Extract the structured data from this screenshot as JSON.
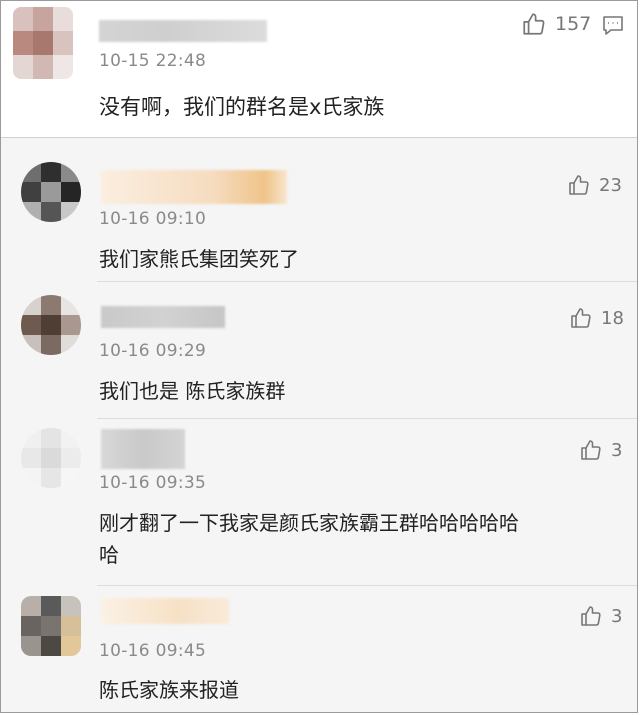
{
  "main": {
    "time": "10-15 22:48",
    "text": "没有啊，我们的群名是x氏家族",
    "likes": "157",
    "like_icon": "thumbs-up-icon",
    "reply_icon": "comment-icon"
  },
  "replies": [
    {
      "time": "10-16 09:10",
      "text": "我们家熊氏集团笑死了",
      "likes": "23"
    },
    {
      "time": "10-16 09:29",
      "text": "我们也是 陈氏家族群",
      "likes": "18"
    },
    {
      "time": "10-16 09:35",
      "text": "刚才翻了一下我家是颜氏家族霸王群哈哈哈哈哈\n哈",
      "likes": "3"
    },
    {
      "time": "10-16 09:45",
      "text": "陈氏家族来报道",
      "likes": "3"
    }
  ],
  "colors": {
    "background_main": "#ffffff",
    "background_replies": "#f5f5f5",
    "time_text": "#8a8a8a",
    "icon": "#777777"
  }
}
